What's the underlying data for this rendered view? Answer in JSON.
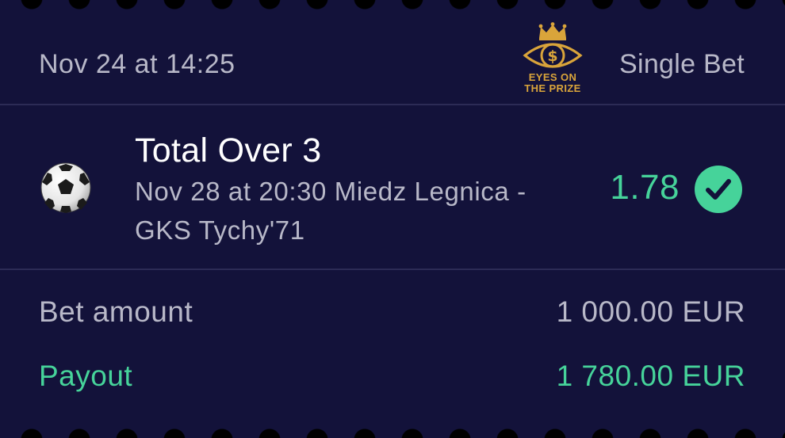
{
  "header": {
    "date": "Nov 24 at 14:25",
    "bet_type": "Single Bet",
    "logo": {
      "line1": "EYES ON",
      "line2": "THE PRIZE",
      "icon": "crowned-eye-dollar-icon",
      "color": "#d9a43a"
    }
  },
  "selection": {
    "sport_icon": "soccer-ball-icon",
    "market": "Total Over 3",
    "event_line1": "Nov 28 at 20:30 Miedz Legnica -",
    "event_line2": "GKS Tychy'71",
    "odds": "1.78",
    "status_icon": "checkmark-circle-icon",
    "status_color": "#46d39a"
  },
  "summary": {
    "bet_amount_label": "Bet amount",
    "bet_amount_value": "1 000.00 EUR",
    "payout_label": "Payout",
    "payout_value": "1 780.00 EUR"
  },
  "colors": {
    "background": "#13123a",
    "accent_green": "#46d39a",
    "muted_text": "#b8b8c8",
    "divider": "#2c2b55"
  }
}
